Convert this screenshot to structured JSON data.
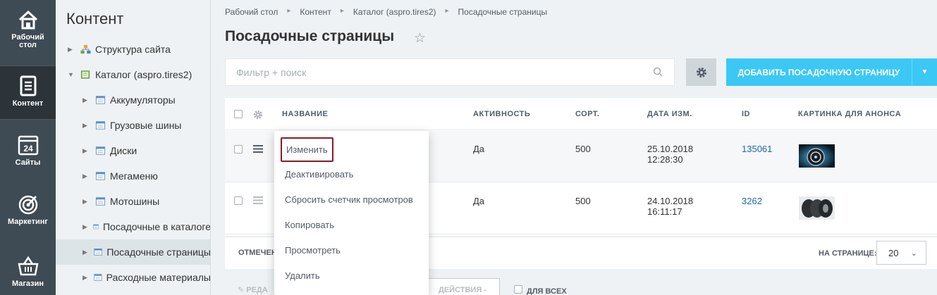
{
  "leftbar": {
    "items": [
      {
        "label_line1": "Рабочий",
        "label_line2": "стол",
        "icon": "home-icon"
      },
      {
        "label_line1": "Контент",
        "label_line2": "",
        "icon": "document-icon"
      },
      {
        "label_line1": "Сайты",
        "label_line2": "",
        "icon": "calendar-icon",
        "badge": "24"
      },
      {
        "label_line1": "Маркетинг",
        "label_line2": "",
        "icon": "target-icon"
      },
      {
        "label_line1": "Магазин",
        "label_line2": "",
        "icon": "basket-icon"
      }
    ],
    "active_index": 1
  },
  "tree": {
    "title": "Контент",
    "nodes": [
      {
        "label": "Структура сайта",
        "icon": "site-structure-icon",
        "expanded": false
      },
      {
        "label": "Каталог (aspro.tires2)",
        "icon": "catalog-icon",
        "expanded": true
      },
      {
        "label": "Аккумуляторы",
        "icon": "iblock-icon"
      },
      {
        "label": "Грузовые шины",
        "icon": "iblock-icon"
      },
      {
        "label": "Диски",
        "icon": "iblock-icon"
      },
      {
        "label": "Мегаменю",
        "icon": "iblock-icon"
      },
      {
        "label": "Мотошины",
        "icon": "iblock-icon"
      },
      {
        "label": "Посадочные в каталоге",
        "icon": "iblock-icon"
      },
      {
        "label": "Посадочные страницы",
        "icon": "iblock-icon",
        "selected": true
      },
      {
        "label": "Расходные материалы",
        "icon": "iblock-icon"
      }
    ]
  },
  "breadcrumbs": [
    "Рабочий стол",
    "Контент",
    "Каталог (aspro.tires2)",
    "Посадочные страницы"
  ],
  "page_title": "Посадочные страницы",
  "filter": {
    "placeholder": "Фильтр + поиск"
  },
  "add_button": {
    "label": "ДОБАВИТЬ ПОСАДОЧНУЮ СТРАНИЦУ"
  },
  "table": {
    "columns": [
      "НАЗВАНИЕ",
      "АКТИВНОСТЬ",
      "СОРТ.",
      "ДАТА ИЗМ.",
      "ID",
      "КАРТИНКА ДЛЯ АНОНСА"
    ],
    "rows": [
      {
        "active": "Да",
        "sort": "500",
        "date": "25.10.2018",
        "time": "12:28:30",
        "id": "135061"
      },
      {
        "active": "Да",
        "sort": "500",
        "date": "24.10.2018",
        "time": "16:11:17",
        "id": "3262"
      }
    ]
  },
  "footer": {
    "selected_label": "ОТМЕЧЕН",
    "per_page_label": "НА СТРАНИЦЕ:",
    "per_page_value": "20",
    "edit_label": "РЕДА",
    "actions_label": "ДЕЙСТВИЯ -",
    "for_all_label": "ДЛЯ ВСЕХ"
  },
  "context_menu": {
    "items": [
      "Изменить",
      "Деактивировать",
      "Сбросить счетчик просмотров",
      "Копировать",
      "Просмотреть",
      "Удалить"
    ]
  },
  "colors": {
    "leftbar": "#3f4b54",
    "accent": "#3bc8f5",
    "link": "#2067b0",
    "highlight_border": "#8b1a28"
  }
}
